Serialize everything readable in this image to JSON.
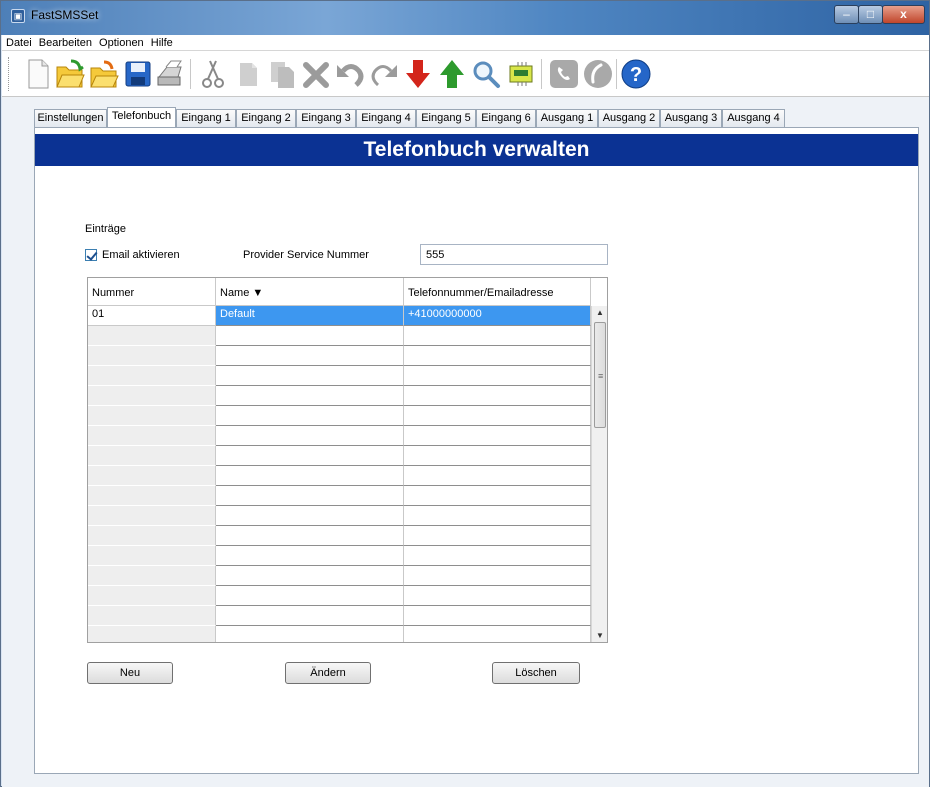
{
  "window": {
    "title": "FastSMSSet",
    "minimize_glyph": "–",
    "maximize_glyph": "□",
    "close_glyph": "x"
  },
  "menu": [
    "Datei",
    "Bearbeiten",
    "Optionen",
    "Hilfe"
  ],
  "toolbar": {
    "icons": [
      "new-icon",
      "open-icon",
      "open-folder-icon",
      "save-icon",
      "print-icon",
      "cut-icon",
      "copy-icon",
      "paste-icon",
      "delete-icon",
      "undo-icon",
      "redo-icon",
      "download-icon",
      "upload-icon",
      "search-icon",
      "device-icon",
      "phone-icon",
      "call-icon",
      "help-icon"
    ],
    "help_label": "?"
  },
  "tabs": [
    "Einstellungen",
    "Telefonbuch",
    "Eingang 1",
    "Eingang 2",
    "Eingang 3",
    "Eingang 4",
    "Eingang 5",
    "Eingang 6",
    "Ausgang 1",
    "Ausgang 2",
    "Ausgang 3",
    "Ausgang 4"
  ],
  "active_tab": "Telefonbuch",
  "panel": {
    "banner": "Telefonbuch verwalten",
    "section_label": "Einträge",
    "email_checkbox_label": "Email aktivieren",
    "email_checked": true,
    "provider_label": "Provider Service Nummer",
    "provider_value": "555"
  },
  "table": {
    "columns": [
      "Nummer",
      "Name ▼",
      "Telefonnummer/Emailadresse"
    ],
    "rows": [
      {
        "nummer": "01",
        "name": "Default",
        "telefon": "+41000000000",
        "selected": true
      }
    ],
    "empty_rows": 16
  },
  "scrollbar": {
    "up": "▲",
    "down": "▼",
    "grip": "≡"
  },
  "buttons": {
    "neu": "Neu",
    "aendern": "Ändern",
    "loeschen": "Löschen"
  },
  "colors": {
    "banner": "#0b3293",
    "selection": "#3d97f0"
  }
}
